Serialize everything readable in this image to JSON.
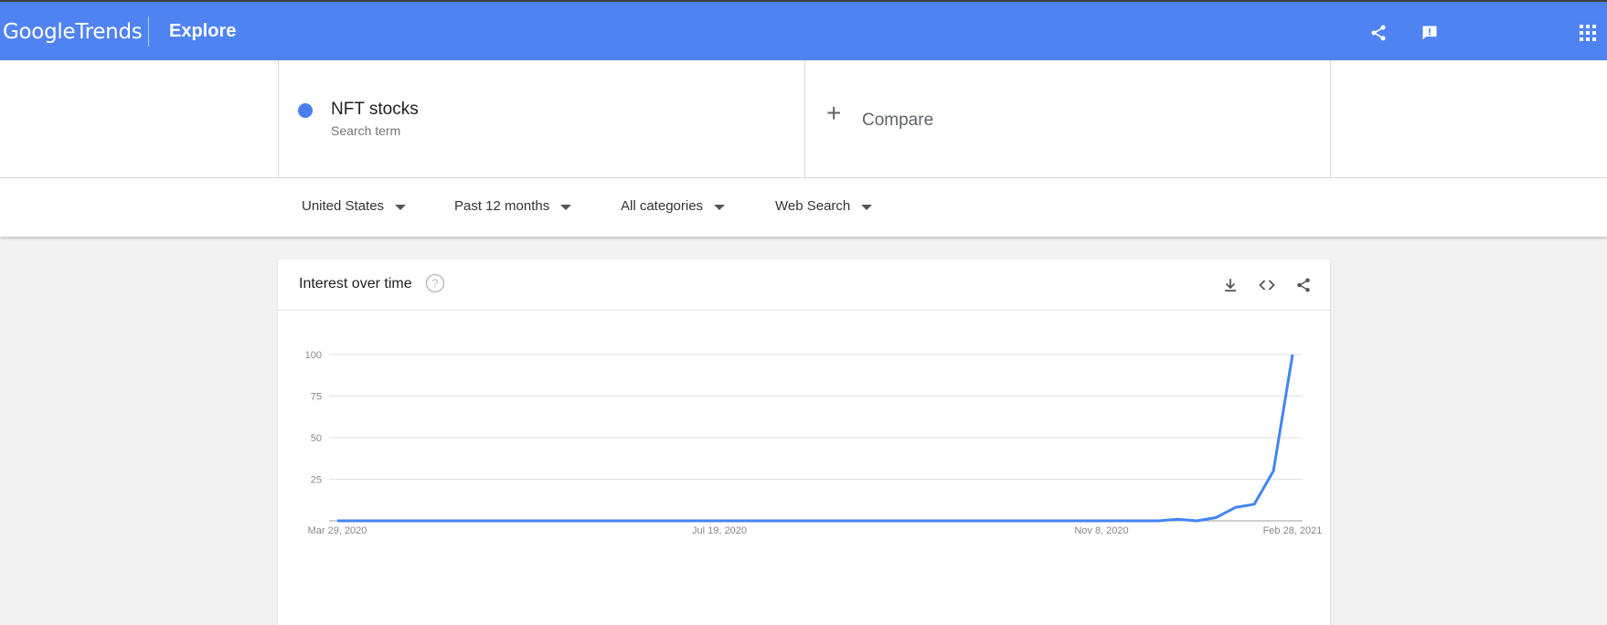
{
  "app": {
    "logo_google": "Google",
    "logo_trends": "Trends",
    "page_title": "Explore"
  },
  "appbar_icons": [
    "share-icon",
    "feedback-icon",
    "apps-grid-icon"
  ],
  "search": {
    "term": "NFT stocks",
    "term_type": "Search term",
    "term_color": "#4a7ff0",
    "compare_label": "Compare"
  },
  "filters": {
    "region": "United States",
    "time_range": "Past 12 months",
    "category": "All categories",
    "search_type": "Web Search"
  },
  "card": {
    "title": "Interest over time",
    "icons": [
      "help-icon",
      "download-icon",
      "embed-code-icon",
      "share-icon"
    ]
  },
  "chart_data": {
    "type": "line",
    "title": "",
    "xlabel": "",
    "ylabel": "",
    "ylim": [
      0,
      100
    ],
    "yticks": [
      25,
      50,
      75,
      100
    ],
    "xticks": [
      "Mar 29, 2020",
      "Jul 19, 2020",
      "Nov 8, 2020",
      "Feb 28, 2021"
    ],
    "grid": true,
    "series": [
      {
        "color": "#4285f4",
        "values": [
          0,
          0,
          0,
          0,
          0,
          0,
          0,
          0,
          0,
          0,
          0,
          0,
          0,
          0,
          0,
          0,
          0,
          0,
          0,
          0,
          0,
          0,
          0,
          0,
          0,
          0,
          0,
          0,
          0,
          0,
          0,
          0,
          0,
          0,
          0,
          0,
          0,
          0,
          0,
          0,
          0,
          0,
          0,
          0,
          1,
          0,
          2,
          8,
          10,
          30,
          100
        ]
      }
    ]
  }
}
